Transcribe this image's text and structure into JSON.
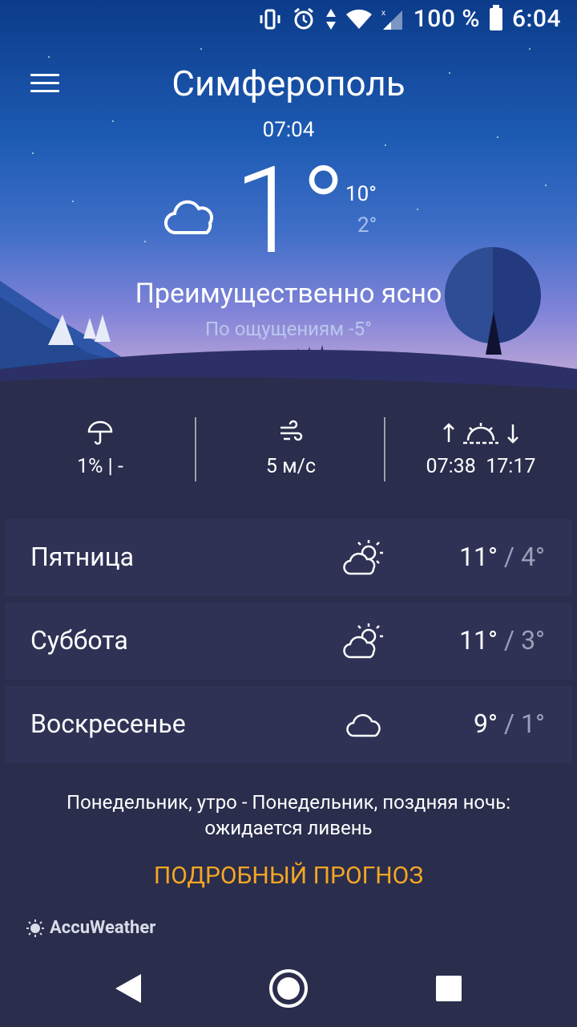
{
  "status_bar": {
    "battery": "100 %",
    "time": "6:04"
  },
  "header": {
    "city": "Симферополь",
    "local_time": "07:04"
  },
  "current": {
    "temperature": "1°",
    "high": "10°",
    "low": "2°",
    "condition": "Преимущественно ясно",
    "feels_like": "По ощущениям -5°",
    "icon": "cloud-moon-icon"
  },
  "stats": {
    "precipitation": "1% | -",
    "wind": "5 м/с",
    "sunrise": "07:38",
    "sunset": "17:17"
  },
  "forecast": [
    {
      "day": "Пятница",
      "high": "11°",
      "sep": "/",
      "low": "4°",
      "icon": "sun-cloud-icon"
    },
    {
      "day": "Суббота",
      "high": "11°",
      "sep": "/",
      "low": "3°",
      "icon": "sun-cloud-icon"
    },
    {
      "day": "Воскресенье",
      "high": "9°",
      "sep": "/",
      "low": "1°",
      "icon": "cloud-icon"
    }
  ],
  "note": {
    "line1": "Понедельник, утро - Понедельник, поздняя ночь:",
    "line2": "ожидается ливень"
  },
  "forecast_link": "ПОДРОБНЫЙ ПРОГНОЗ",
  "brand": "AccuWeather",
  "colors": {
    "accent": "#f5a623",
    "background": "#2a2d4c",
    "row": "#2f3255"
  }
}
